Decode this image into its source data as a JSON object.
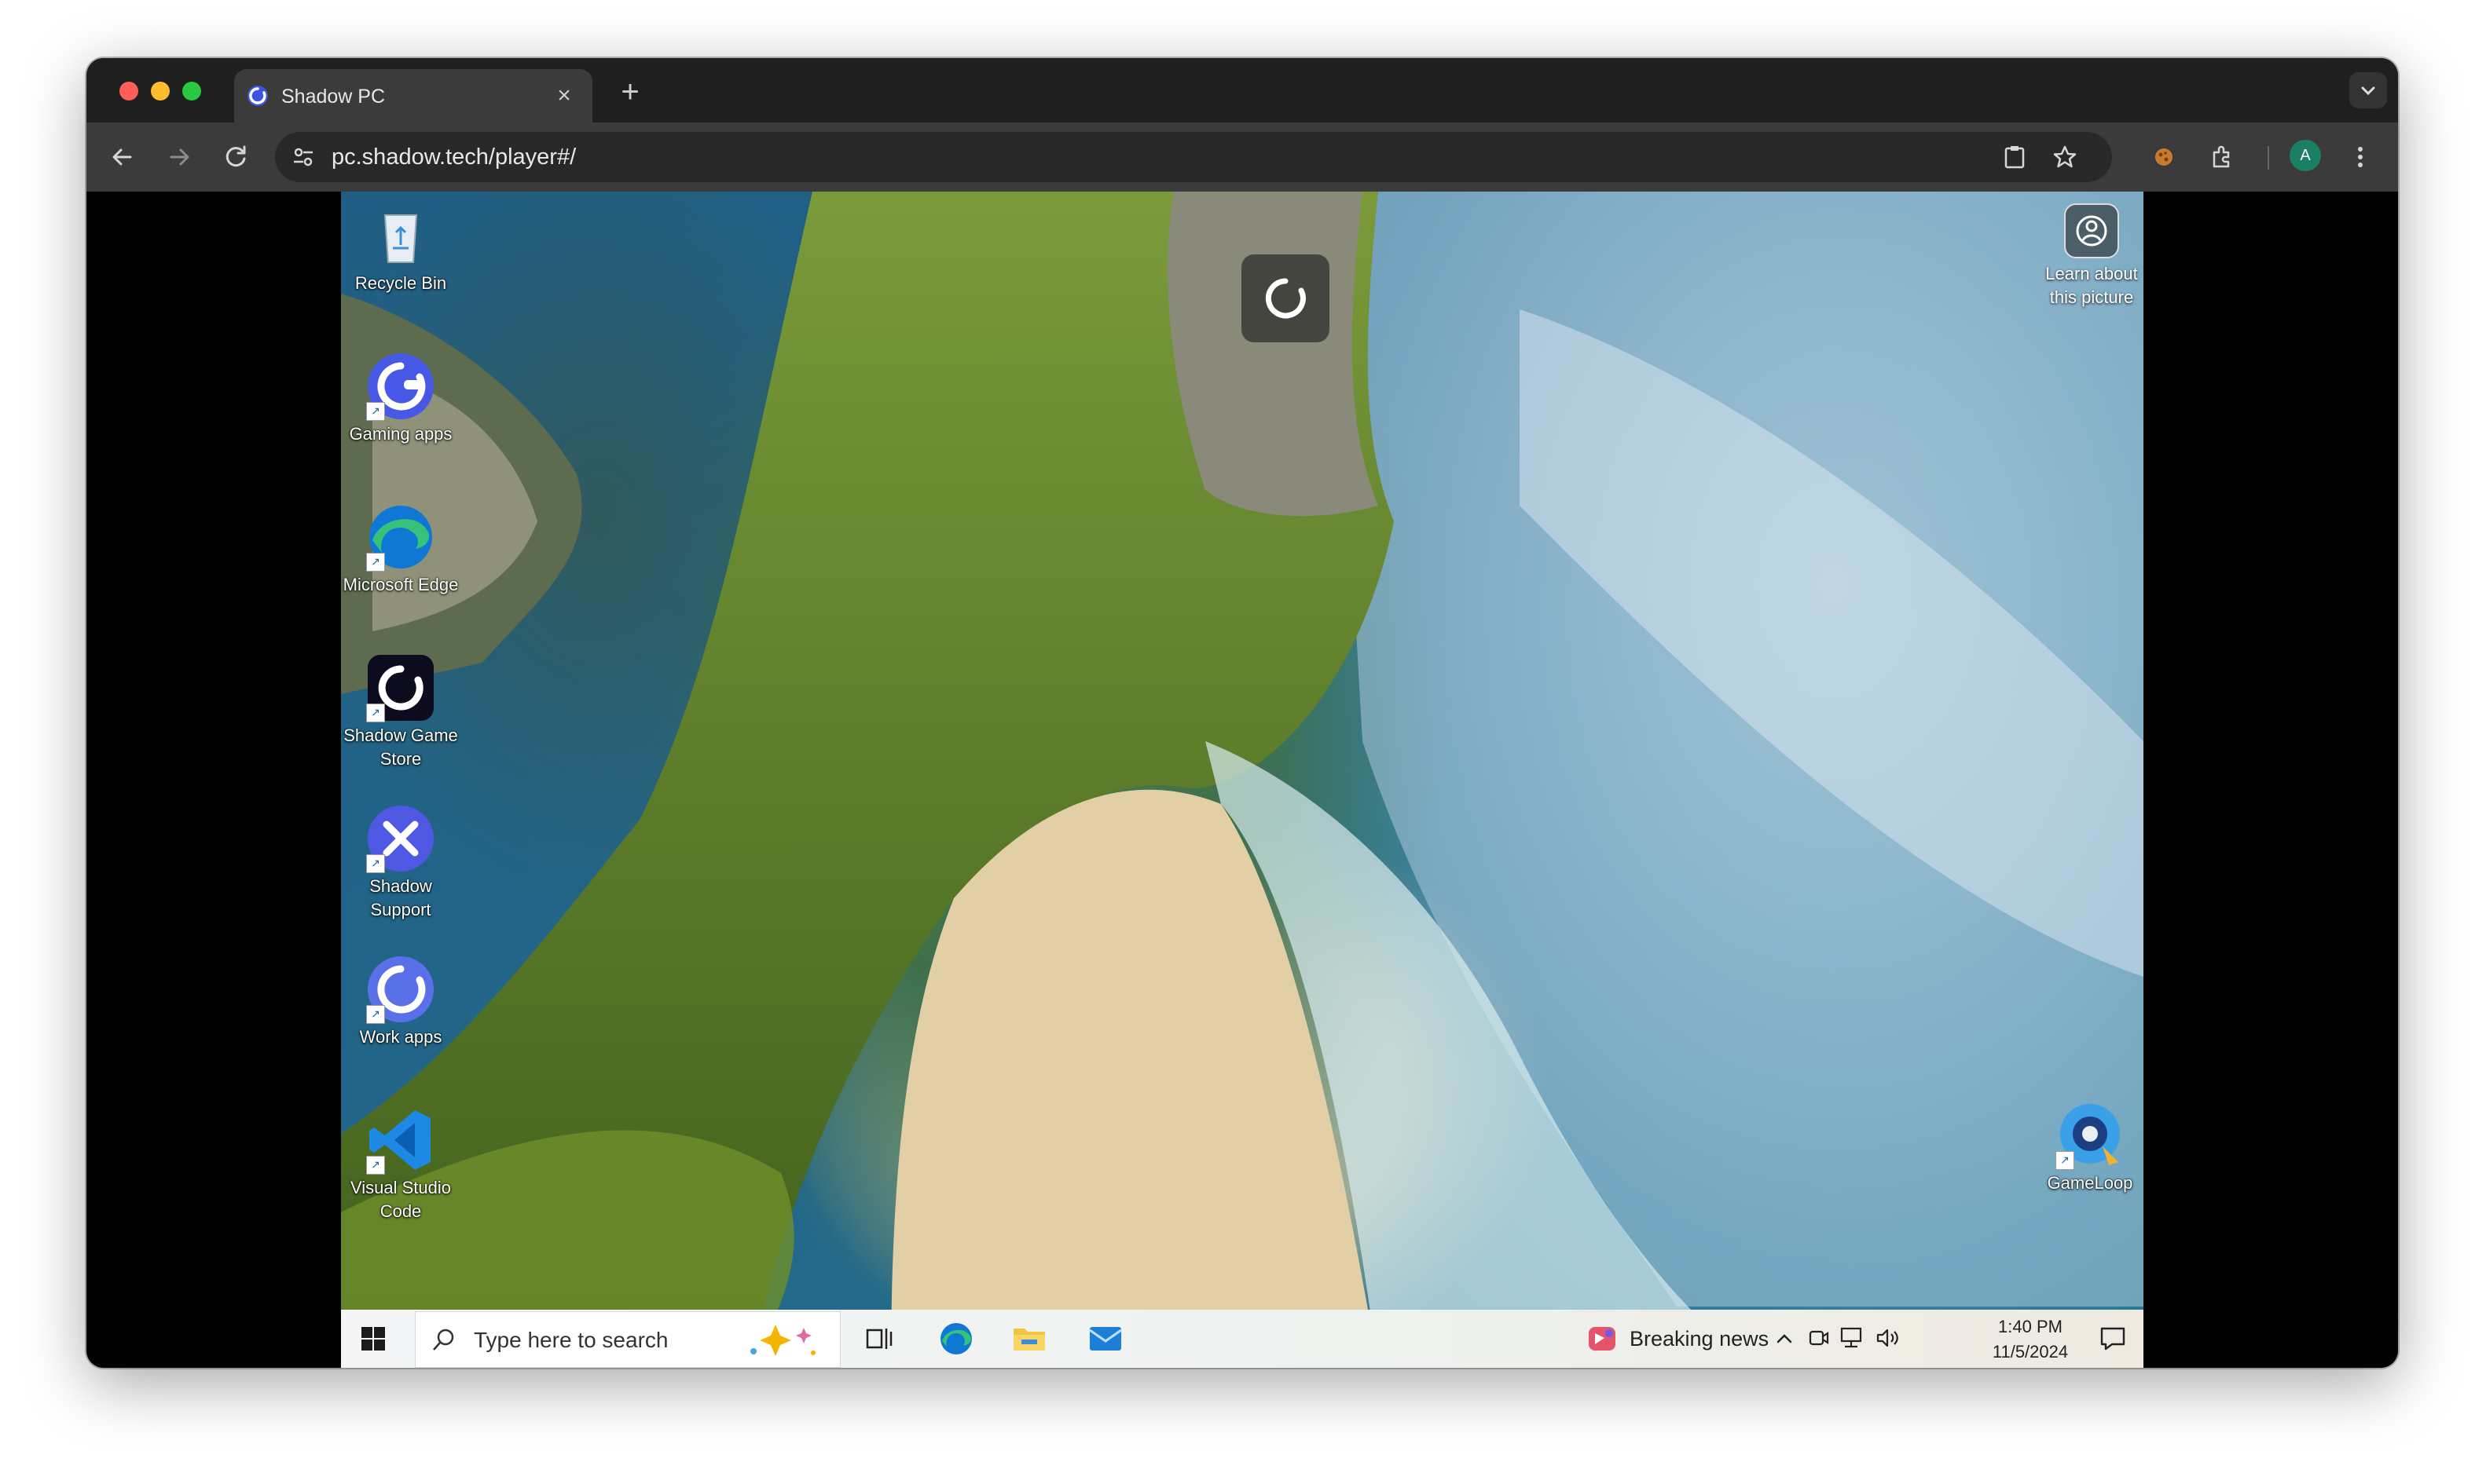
{
  "browser": {
    "tab": {
      "title": "Shadow PC"
    },
    "address_bar": {
      "url": "pc.shadow.tech/player#/"
    },
    "profile_initial": "A"
  },
  "desktop": {
    "icons": [
      {
        "label": "Recycle Bin"
      },
      {
        "label": "Gaming apps"
      },
      {
        "label": "Microsoft Edge"
      },
      {
        "label": "Shadow Game Store"
      },
      {
        "label": "Shadow Support"
      },
      {
        "label": "Work apps"
      },
      {
        "label": "Visual Studio Code"
      }
    ],
    "right_icons": [
      {
        "label": "Learn about this picture"
      },
      {
        "label": "GameLoop"
      }
    ]
  },
  "taskbar": {
    "search_placeholder": "Type here to search",
    "news_label": "Breaking news",
    "time": "1:40 PM",
    "date": "11/5/2024"
  },
  "colors": {
    "accent_shadow": "#3d54e0",
    "edge_blue": "#0f78d4",
    "vscode_blue": "#1e88e5"
  }
}
